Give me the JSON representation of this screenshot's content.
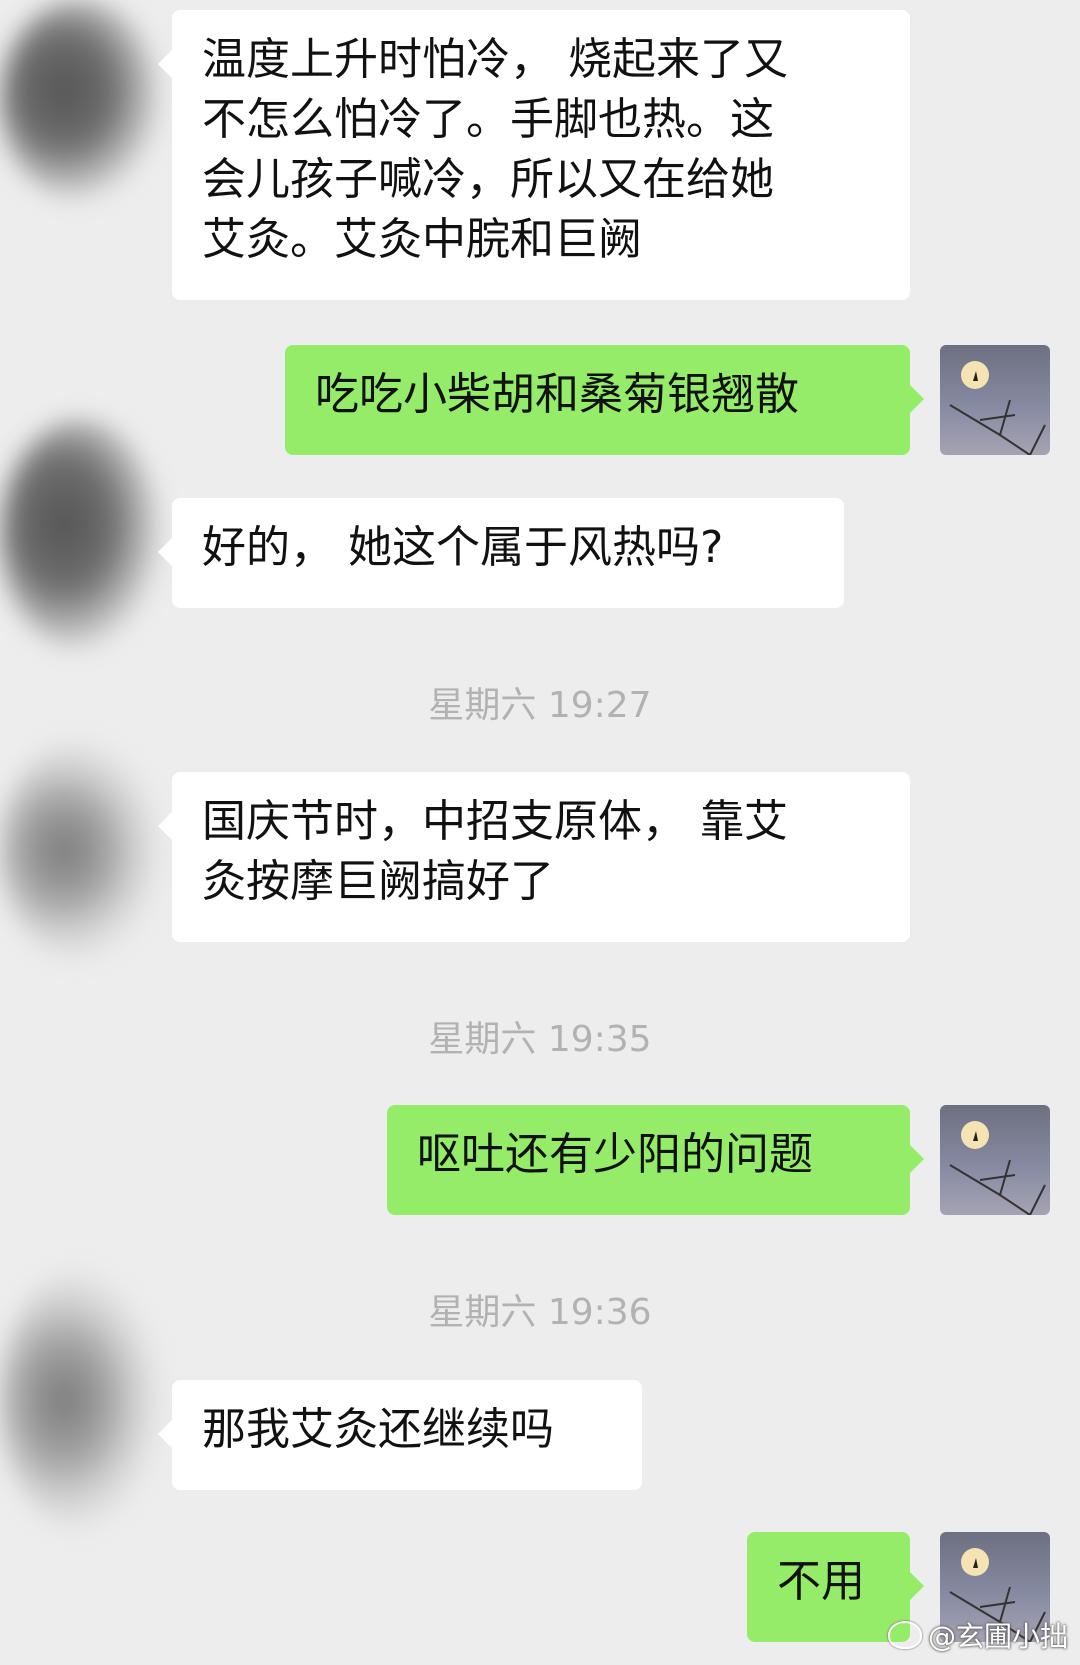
{
  "messages": [
    {
      "from": "contact",
      "text": "温度上升时怕冷， 烧起来了又\n不怎么怕冷了。手脚也热。这\n会儿孩子喊冷，所以又在给她\n艾灸。艾灸中脘和巨阙"
    },
    {
      "from": "me",
      "text": "吃吃小柴胡和桑菊银翘散"
    },
    {
      "from": "contact",
      "text": "好的， 她这个属于风热吗?"
    },
    {
      "from": "contact",
      "text": "国庆节时，中招支原体， 靠艾\n灸按摩巨阙搞好了"
    },
    {
      "from": "me",
      "text": "呕吐还有少阳的问题"
    },
    {
      "from": "contact",
      "text": "那我艾灸还继续吗"
    },
    {
      "from": "me",
      "text": "不用"
    }
  ],
  "timestamps": [
    "星期六 19:27",
    "星期六 19:35",
    "星期六 19:36"
  ],
  "watermark": "@玄圃小拙",
  "colors": {
    "background": "#ededed",
    "incoming_bubble": "#ffffff",
    "outgoing_bubble": "#95ec69",
    "timestamp": "#b2b2b2"
  },
  "icons": {
    "watermark_logo": "weibo-icon",
    "my_avatar": "moon-branch-avatar",
    "contact_avatar": "blurred-avatar"
  }
}
